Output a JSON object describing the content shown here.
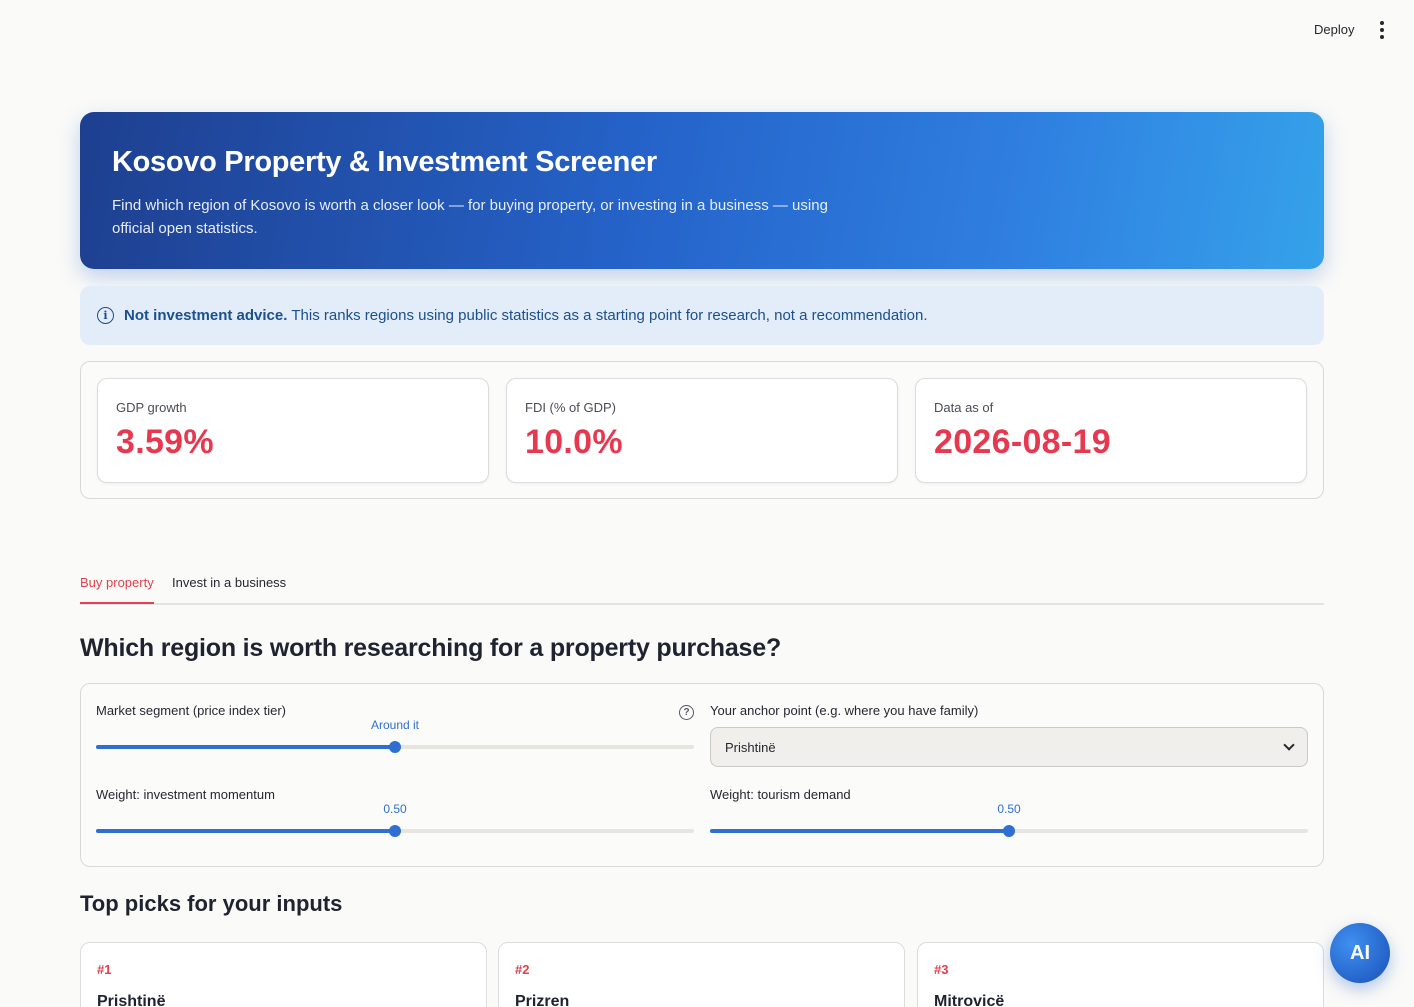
{
  "header": {
    "deploy_label": "Deploy",
    "menu_icon": "kebab-menu-icon"
  },
  "hero": {
    "title": "Kosovo Property & Investment Screener",
    "subtitle": "Find which region of Kosovo is worth a closer look — for buying property, or investing in a business — using official open statistics."
  },
  "notice": {
    "icon": "info-icon",
    "bold": "Not investment advice.",
    "text": "This ranks regions using public statistics as a starting point for research, not a recommendation."
  },
  "metrics": [
    {
      "label": "GDP growth",
      "value": "3.59%"
    },
    {
      "label": "FDI (% of GDP)",
      "value": "10.0%"
    },
    {
      "label": "Data as of",
      "value": "2026-08-19"
    }
  ],
  "tabs": [
    {
      "label": "Buy property",
      "active": true
    },
    {
      "label": "Invest in a business",
      "active": false
    }
  ],
  "main": {
    "question": "Which region is worth researching for a property purchase?",
    "top_picks_heading": "Top picks for your inputs"
  },
  "controls": {
    "market_segment": {
      "label": "Market segment (price index tier)",
      "value_label": "Around it",
      "fraction": 0.5
    },
    "anchor": {
      "label": "Your anchor point (e.g. where you have family)",
      "selected": "Prishtinë"
    },
    "weight_momentum": {
      "label": "Weight: investment momentum",
      "value_label": "0.50",
      "fraction": 0.5
    },
    "weight_tourism": {
      "label": "Weight: tourism demand",
      "value_label": "0.50",
      "fraction": 0.5
    }
  },
  "picks": [
    {
      "rank": "#1",
      "name": "Prishtinë"
    },
    {
      "rank": "#2",
      "name": "Prizren"
    },
    {
      "rank": "#3",
      "name": "Mitrovicë"
    }
  ],
  "assistant": {
    "label": "AI"
  },
  "colors": {
    "accent_red": "#e0404f",
    "metric_red": "#e63950",
    "slider_blue": "#2f6fd1",
    "hero_start": "#1e3f8f",
    "hero_end": "#35a2ea",
    "info_bg": "#e3edfa"
  }
}
